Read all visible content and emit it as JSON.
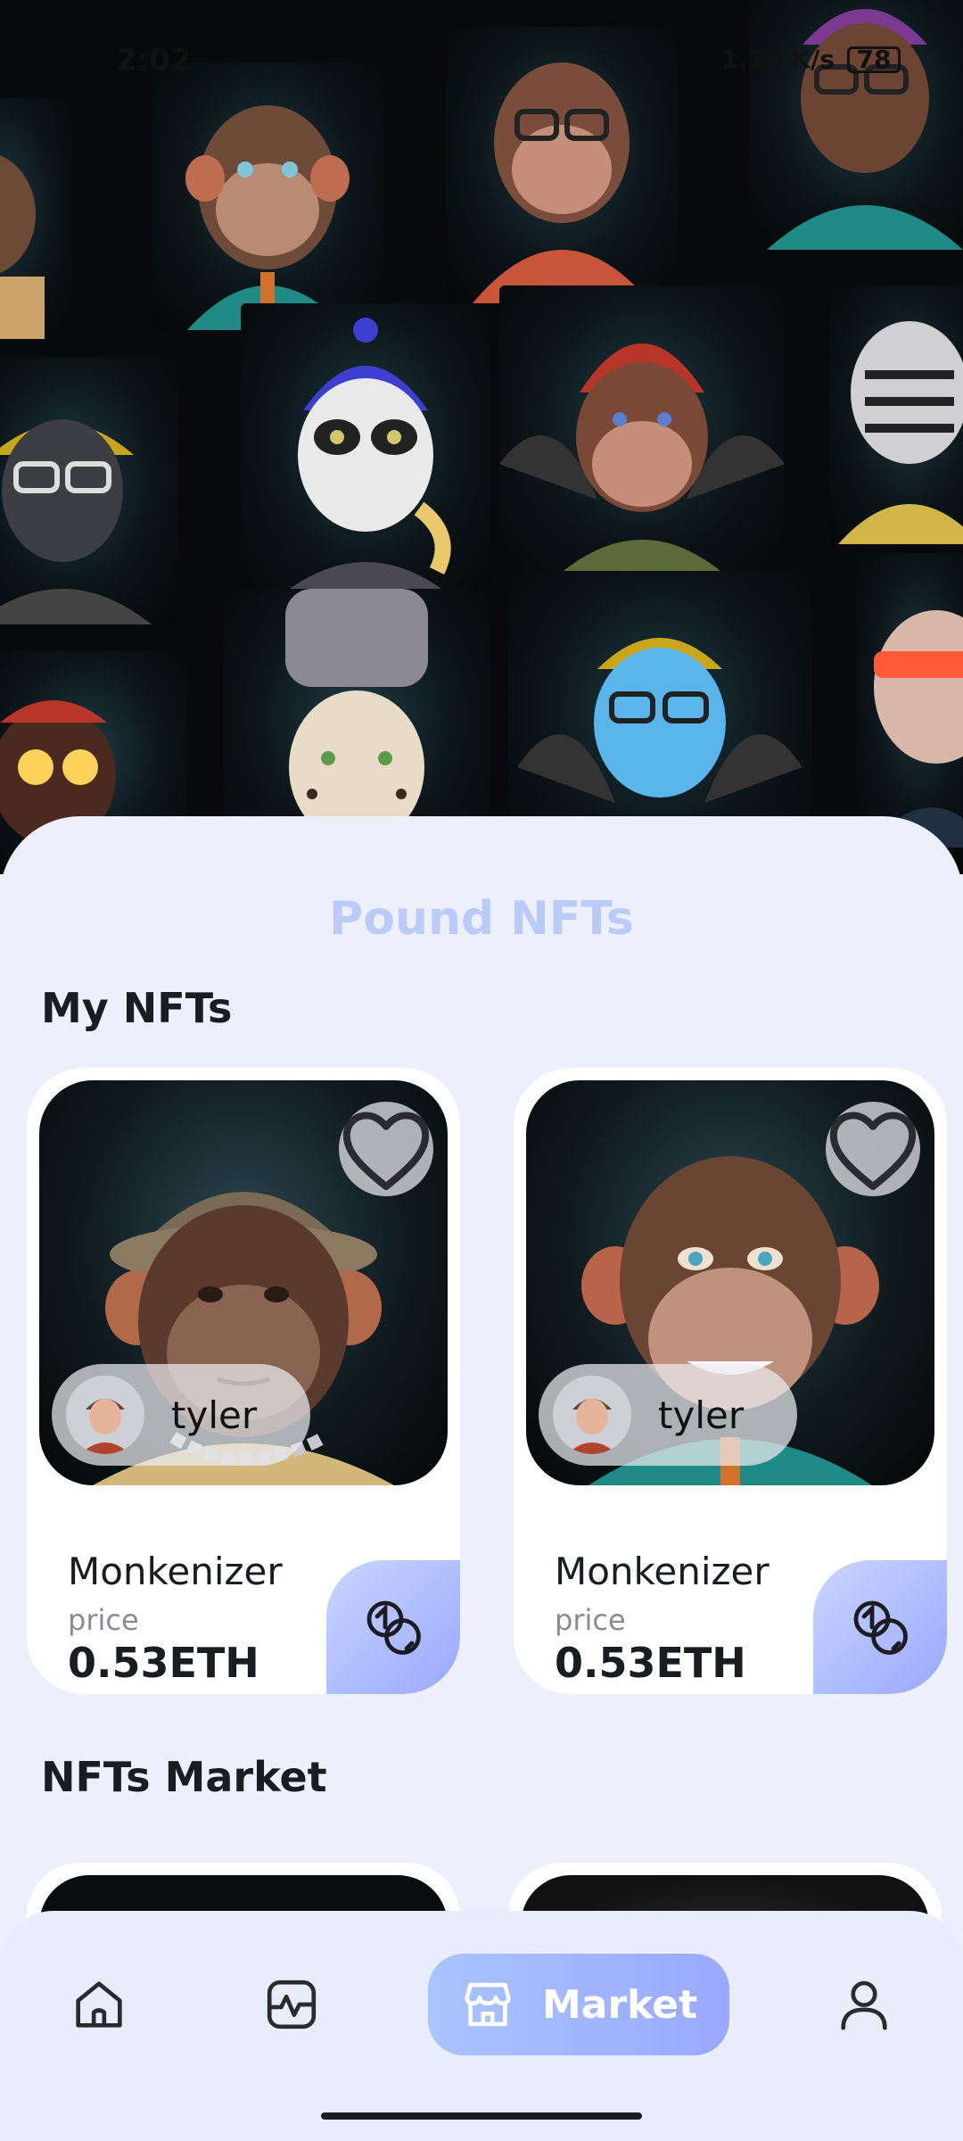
{
  "status_bar": {
    "time": "2:02",
    "network": "1.12 K/s",
    "battery": "78"
  },
  "app": {
    "title": "Pound NFTs"
  },
  "my_nfts": {
    "heading": "My NFTs",
    "cards": [
      {
        "owner": "tyler",
        "name": "Monkenizer",
        "price_label": "price",
        "price": "0.53ETH"
      },
      {
        "owner": "tyler",
        "name": "Monkenizer",
        "price_label": "price",
        "price": "0.53ETH"
      }
    ]
  },
  "market": {
    "heading": "NFTs Market"
  },
  "nav": {
    "items": [
      {
        "icon": "home-icon"
      },
      {
        "icon": "activity-icon"
      },
      {
        "icon": "market-icon",
        "label": "Market",
        "active": true
      },
      {
        "icon": "profile-icon"
      }
    ]
  },
  "colors": {
    "accent": "#9aa8ff",
    "title": "#b9cbf6",
    "background": "#eeeffc"
  }
}
